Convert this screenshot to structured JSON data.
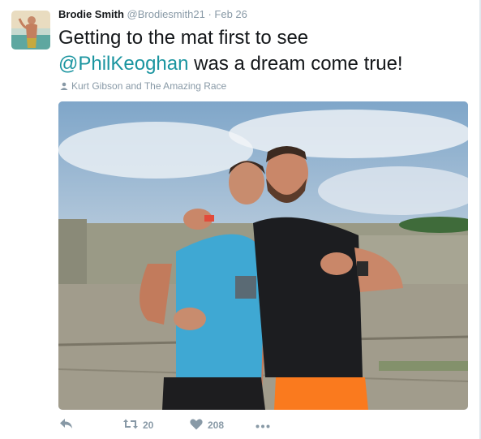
{
  "tweet": {
    "author_name": "Brodie Smith",
    "author_handle": "@Brodiesmith21",
    "separator": "·",
    "timestamp": "Feb 26",
    "text_line1": "Getting to the mat first to see",
    "mention": "@PhilKeoghan",
    "text_rest": " was a dream come true!",
    "tagged_users": "Kurt Gibson and The Amazing Race"
  },
  "actions": {
    "reply_icon": "reply-icon",
    "retweet_icon": "retweet-icon",
    "retweet_count": "20",
    "like_icon": "heart-icon",
    "like_count": "208",
    "more_icon": "more-icon"
  },
  "colors": {
    "link": "#1b95a0",
    "secondary": "#8899a6",
    "text": "#14171a"
  }
}
